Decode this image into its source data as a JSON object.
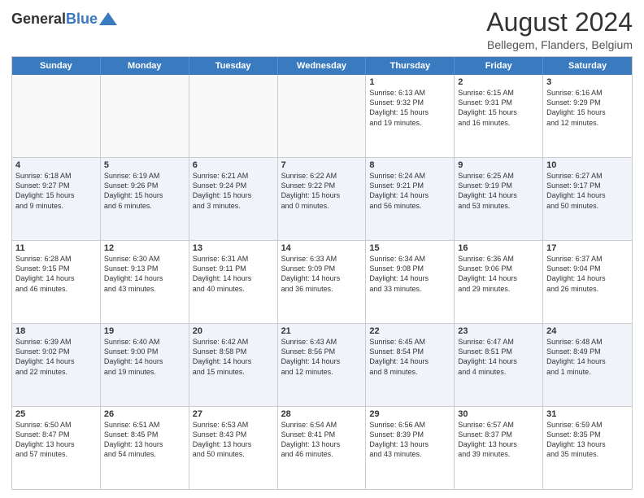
{
  "logo": {
    "general": "General",
    "blue": "Blue"
  },
  "header": {
    "month_year": "August 2024",
    "location": "Bellegem, Flanders, Belgium"
  },
  "days_of_week": [
    "Sunday",
    "Monday",
    "Tuesday",
    "Wednesday",
    "Thursday",
    "Friday",
    "Saturday"
  ],
  "rows": [
    {
      "cells": [
        {
          "day": "",
          "text": "",
          "empty": true
        },
        {
          "day": "",
          "text": "",
          "empty": true
        },
        {
          "day": "",
          "text": "",
          "empty": true
        },
        {
          "day": "",
          "text": "",
          "empty": true
        },
        {
          "day": "1",
          "text": "Sunrise: 6:13 AM\nSunset: 9:32 PM\nDaylight: 15 hours\nand 19 minutes."
        },
        {
          "day": "2",
          "text": "Sunrise: 6:15 AM\nSunset: 9:31 PM\nDaylight: 15 hours\nand 16 minutes."
        },
        {
          "day": "3",
          "text": "Sunrise: 6:16 AM\nSunset: 9:29 PM\nDaylight: 15 hours\nand 12 minutes."
        }
      ]
    },
    {
      "cells": [
        {
          "day": "4",
          "text": "Sunrise: 6:18 AM\nSunset: 9:27 PM\nDaylight: 15 hours\nand 9 minutes."
        },
        {
          "day": "5",
          "text": "Sunrise: 6:19 AM\nSunset: 9:26 PM\nDaylight: 15 hours\nand 6 minutes."
        },
        {
          "day": "6",
          "text": "Sunrise: 6:21 AM\nSunset: 9:24 PM\nDaylight: 15 hours\nand 3 minutes."
        },
        {
          "day": "7",
          "text": "Sunrise: 6:22 AM\nSunset: 9:22 PM\nDaylight: 15 hours\nand 0 minutes."
        },
        {
          "day": "8",
          "text": "Sunrise: 6:24 AM\nSunset: 9:21 PM\nDaylight: 14 hours\nand 56 minutes."
        },
        {
          "day": "9",
          "text": "Sunrise: 6:25 AM\nSunset: 9:19 PM\nDaylight: 14 hours\nand 53 minutes."
        },
        {
          "day": "10",
          "text": "Sunrise: 6:27 AM\nSunset: 9:17 PM\nDaylight: 14 hours\nand 50 minutes."
        }
      ]
    },
    {
      "cells": [
        {
          "day": "11",
          "text": "Sunrise: 6:28 AM\nSunset: 9:15 PM\nDaylight: 14 hours\nand 46 minutes."
        },
        {
          "day": "12",
          "text": "Sunrise: 6:30 AM\nSunset: 9:13 PM\nDaylight: 14 hours\nand 43 minutes."
        },
        {
          "day": "13",
          "text": "Sunrise: 6:31 AM\nSunset: 9:11 PM\nDaylight: 14 hours\nand 40 minutes."
        },
        {
          "day": "14",
          "text": "Sunrise: 6:33 AM\nSunset: 9:09 PM\nDaylight: 14 hours\nand 36 minutes."
        },
        {
          "day": "15",
          "text": "Sunrise: 6:34 AM\nSunset: 9:08 PM\nDaylight: 14 hours\nand 33 minutes."
        },
        {
          "day": "16",
          "text": "Sunrise: 6:36 AM\nSunset: 9:06 PM\nDaylight: 14 hours\nand 29 minutes."
        },
        {
          "day": "17",
          "text": "Sunrise: 6:37 AM\nSunset: 9:04 PM\nDaylight: 14 hours\nand 26 minutes."
        }
      ]
    },
    {
      "cells": [
        {
          "day": "18",
          "text": "Sunrise: 6:39 AM\nSunset: 9:02 PM\nDaylight: 14 hours\nand 22 minutes."
        },
        {
          "day": "19",
          "text": "Sunrise: 6:40 AM\nSunset: 9:00 PM\nDaylight: 14 hours\nand 19 minutes."
        },
        {
          "day": "20",
          "text": "Sunrise: 6:42 AM\nSunset: 8:58 PM\nDaylight: 14 hours\nand 15 minutes."
        },
        {
          "day": "21",
          "text": "Sunrise: 6:43 AM\nSunset: 8:56 PM\nDaylight: 14 hours\nand 12 minutes."
        },
        {
          "day": "22",
          "text": "Sunrise: 6:45 AM\nSunset: 8:54 PM\nDaylight: 14 hours\nand 8 minutes."
        },
        {
          "day": "23",
          "text": "Sunrise: 6:47 AM\nSunset: 8:51 PM\nDaylight: 14 hours\nand 4 minutes."
        },
        {
          "day": "24",
          "text": "Sunrise: 6:48 AM\nSunset: 8:49 PM\nDaylight: 14 hours\nand 1 minute."
        }
      ]
    },
    {
      "cells": [
        {
          "day": "25",
          "text": "Sunrise: 6:50 AM\nSunset: 8:47 PM\nDaylight: 13 hours\nand 57 minutes."
        },
        {
          "day": "26",
          "text": "Sunrise: 6:51 AM\nSunset: 8:45 PM\nDaylight: 13 hours\nand 54 minutes."
        },
        {
          "day": "27",
          "text": "Sunrise: 6:53 AM\nSunset: 8:43 PM\nDaylight: 13 hours\nand 50 minutes."
        },
        {
          "day": "28",
          "text": "Sunrise: 6:54 AM\nSunset: 8:41 PM\nDaylight: 13 hours\nand 46 minutes."
        },
        {
          "day": "29",
          "text": "Sunrise: 6:56 AM\nSunset: 8:39 PM\nDaylight: 13 hours\nand 43 minutes."
        },
        {
          "day": "30",
          "text": "Sunrise: 6:57 AM\nSunset: 8:37 PM\nDaylight: 13 hours\nand 39 minutes."
        },
        {
          "day": "31",
          "text": "Sunrise: 6:59 AM\nSunset: 8:35 PM\nDaylight: 13 hours\nand 35 minutes."
        }
      ]
    }
  ]
}
